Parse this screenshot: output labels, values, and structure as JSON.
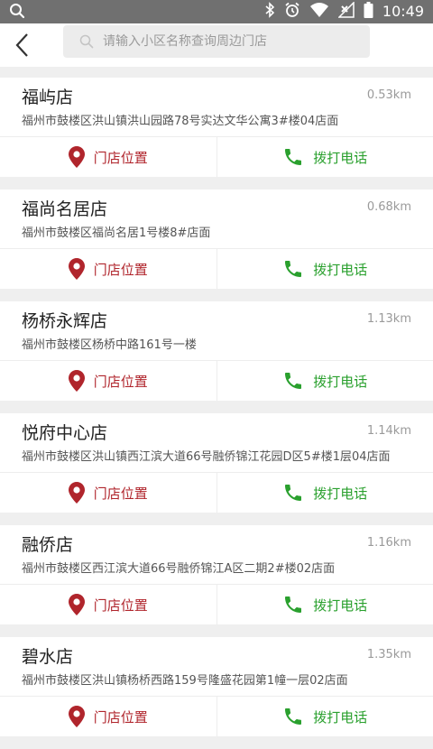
{
  "status_bar": {
    "time": "10:49",
    "icons": [
      "search-icon",
      "bluetooth-icon",
      "alarm-icon",
      "wifi-icon",
      "no-signal-icon",
      "battery-icon"
    ]
  },
  "header": {
    "back_icon": "chevron-left-icon",
    "search_placeholder": "请输入小区名称查询周边门店"
  },
  "colors": {
    "location_red": "#b0252c",
    "call_green": "#2aa02e",
    "background": "#efefef",
    "status_bar": "#707070"
  },
  "actions": {
    "location_label": "门店位置",
    "call_label": "拨打电话"
  },
  "stores": [
    {
      "name": "福屿店",
      "distance": "0.53km",
      "address": "福州市鼓楼区洪山镇洪山园路78号实达文华公寓3#楼04店面"
    },
    {
      "name": "福尚名居店",
      "distance": "0.68km",
      "address": "福州市鼓楼区福尚名居1号楼8#店面"
    },
    {
      "name": "杨桥永辉店",
      "distance": "1.13km",
      "address": "福州市鼓楼区杨桥中路161号一楼"
    },
    {
      "name": "悦府中心店",
      "distance": "1.14km",
      "address": "福州市鼓楼区洪山镇西江滨大道66号融侨锦江花园D区5#楼1层04店面"
    },
    {
      "name": "融侨店",
      "distance": "1.16km",
      "address": "福州市鼓楼区西江滨大道66号融侨锦江A区二期2#楼02店面"
    },
    {
      "name": "碧水店",
      "distance": "1.35km",
      "address": "福州市鼓楼区洪山镇杨桥西路159号隆盛花园第1幢一层02店面"
    }
  ]
}
